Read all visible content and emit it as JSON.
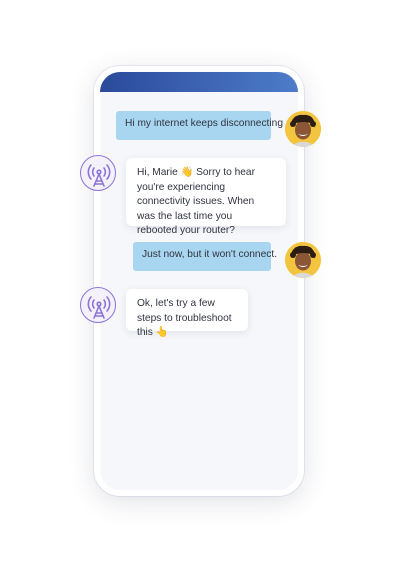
{
  "chat": {
    "messages": [
      {
        "sender": "user",
        "text": "Hi my internet keeps disconnecting"
      },
      {
        "sender": "bot",
        "text": "Hi, Marie 👋 Sorry to hear you're experiencing connectivity issues. When was the last time you rebooted your router?"
      },
      {
        "sender": "user",
        "text": "Just now, but it won't connect."
      },
      {
        "sender": "bot",
        "text": "Ok, let's try a few steps to troubleshoot this 👆"
      }
    ]
  },
  "icons": {
    "user_avatar": "user-photo-avatar",
    "bot_avatar": "antenna-icon"
  },
  "colors": {
    "header": "#3a62b3",
    "user_bubble": "#a8d5ef",
    "bot_bubble": "#ffffff",
    "bot_icon": "#8b74d6",
    "user_avatar_bg": "#f3c43e"
  }
}
